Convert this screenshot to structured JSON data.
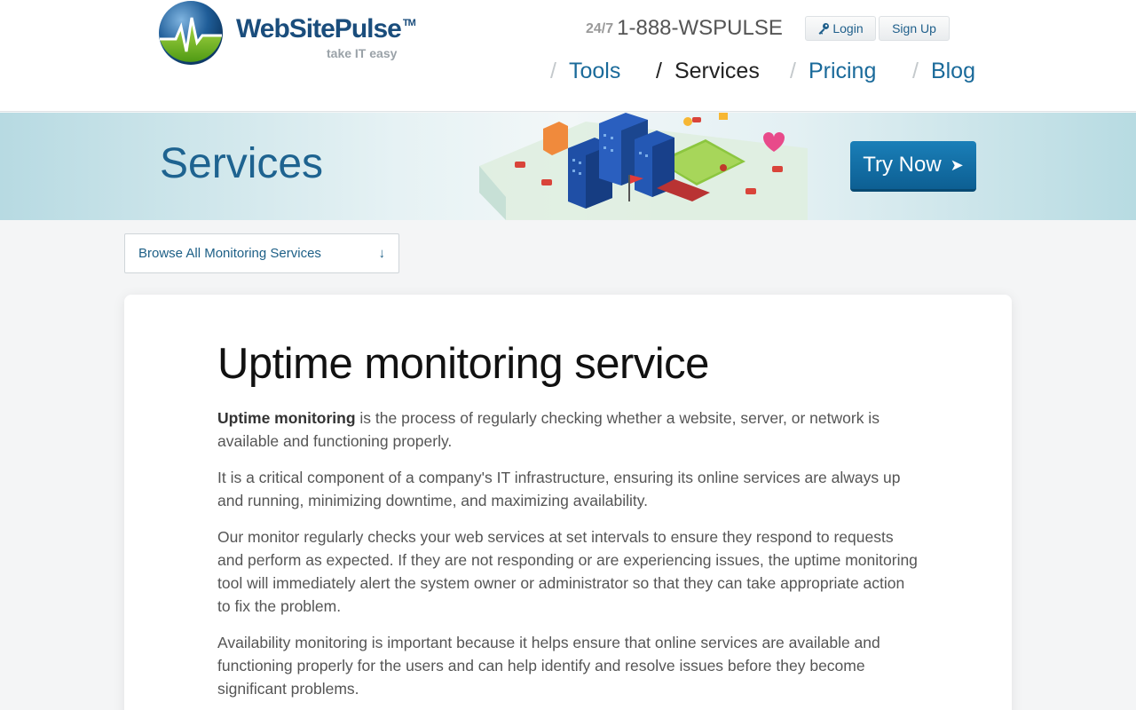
{
  "header": {
    "brand": "WebSitePulse",
    "trademark": "TM",
    "tagline": "take IT easy",
    "phone_prefix": "24/7",
    "phone": "1-888-WSPULSE",
    "login_label": "Login",
    "signup_label": "Sign Up"
  },
  "nav": {
    "separator": "/",
    "items": [
      {
        "label": "Tools",
        "active": false
      },
      {
        "label": "Services",
        "active": true
      },
      {
        "label": "Pricing",
        "active": false
      },
      {
        "label": "Blog",
        "active": false
      }
    ]
  },
  "banner": {
    "title": "Services",
    "cta_label": "Try Now",
    "cta_arrow": "➤"
  },
  "browse": {
    "label": "Browse All Monitoring Services",
    "arrow": "↓"
  },
  "article": {
    "title": "Uptime monitoring service",
    "intro_bold": "Uptime monitoring",
    "intro_rest": " is the process of regularly checking whether a website, server, or network is available and functioning properly.",
    "paragraphs": [
      "It is a critical component of a company's IT infrastructure, ensuring its online services are always up and running, minimizing downtime, and maximizing availability.",
      "Our monitor regularly checks your web services at set intervals to ensure they respond to requests and perform as expected. If they are not responding or are experiencing issues, the uptime monitoring tool will immediately alert the system owner or administrator so that they can take appropriate action to fix the problem.",
      "Availability monitoring is important because it helps ensure that online services are available and functioning properly for the users and can help identify and resolve issues before they become significant problems."
    ]
  },
  "colors": {
    "brand_blue": "#1a4d7c",
    "link_blue": "#1a6a9a",
    "cta_blue": "#0d5f93"
  },
  "icons": [
    "logo-globe-icon",
    "key-icon",
    "chevron-right-icon",
    "arrow-down-icon"
  ]
}
